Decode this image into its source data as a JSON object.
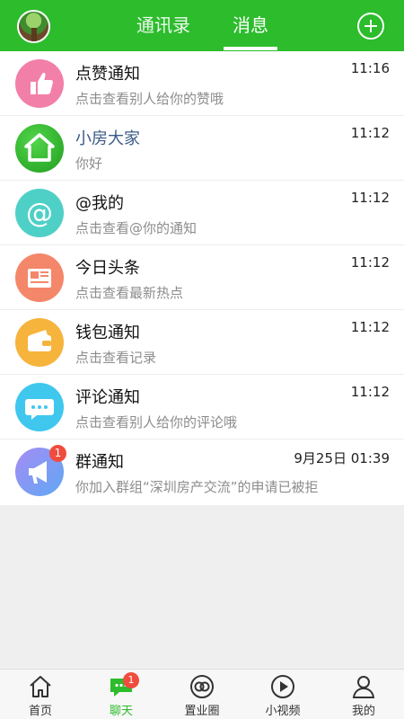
{
  "header": {
    "tabs": [
      {
        "label": "通讯录"
      },
      {
        "label": "消息"
      }
    ],
    "active_tab": "消息",
    "accent_color": "#2cbc2c"
  },
  "messages": [
    {
      "icon": "thumbs-up-icon",
      "color": "#f27fa8",
      "title": "点赞通知",
      "subtitle": "点击查看别人给你的赞哦",
      "time": "11:16"
    },
    {
      "icon": "house-icon",
      "color": "#2cbc2c",
      "title": "小房大家",
      "subtitle": "你好",
      "time": "11:12"
    },
    {
      "icon": "at-sign-icon",
      "color": "#4fd0c6",
      "title": "@我的",
      "subtitle": "点击查看@你的通知",
      "time": "11:12"
    },
    {
      "icon": "newspaper-icon",
      "color": "#f4876a",
      "title": "今日头条",
      "subtitle": "点击查看最新热点",
      "time": "11:12"
    },
    {
      "icon": "wallet-icon",
      "color": "#f6b43c",
      "title": "钱包通知",
      "subtitle": "点击查看记录",
      "time": "11:12"
    },
    {
      "icon": "comment-bubble-icon",
      "color": "#3fc7ee",
      "title": "评论通知",
      "subtitle": "点击查看别人给你的评论哦",
      "time": "11:12"
    },
    {
      "icon": "megaphone-icon",
      "color": "#7b95f5",
      "title": "群通知",
      "subtitle": "你加入群组“深圳房产交流”的申请已被拒",
      "time": "9月25日 01:39",
      "badge": "1"
    }
  ],
  "bottom_nav": {
    "items": [
      {
        "label": "首页",
        "icon": "home-icon"
      },
      {
        "label": "聊天",
        "icon": "chat-icon",
        "badge": "1"
      },
      {
        "label": "置业圈",
        "icon": "circle-icon"
      },
      {
        "label": "小视频",
        "icon": "play-icon"
      },
      {
        "label": "我的",
        "icon": "person-icon"
      }
    ],
    "active": "聊天"
  }
}
